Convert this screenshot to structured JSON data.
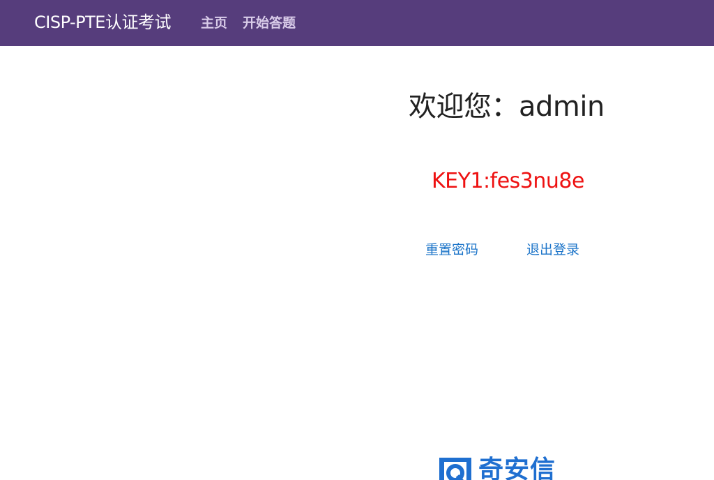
{
  "navbar": {
    "brand": "CISP-PTE认证考试",
    "links": [
      {
        "label": "主页"
      },
      {
        "label": "开始答题"
      }
    ],
    "background_color": "#563d7c"
  },
  "main": {
    "welcome_text": "欢迎您：admin",
    "key_text": "KEY1:fes3nu8e",
    "key_color": "#ee1111",
    "actions": [
      {
        "label": "重置密码"
      },
      {
        "label": "退出登录"
      }
    ]
  },
  "footer": {
    "logo_text": "奇安信",
    "logo_icon": "qianxin-logo-icon"
  }
}
